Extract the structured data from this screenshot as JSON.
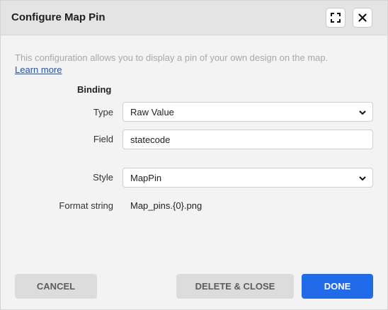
{
  "dialog": {
    "title": "Configure Map Pin",
    "expand_icon": "expand-icon",
    "close_icon": "close-icon"
  },
  "intro": {
    "description": "This configuration allows you to display a pin of your own design on the map.",
    "learn_more": "Learn more"
  },
  "binding": {
    "section_title": "Binding",
    "type_label": "Type",
    "type_value": "Raw Value",
    "field_label": "Field",
    "field_value": "statecode"
  },
  "style": {
    "style_label": "Style",
    "style_value": "MapPin",
    "format_label": "Format string",
    "format_value": "Map_pins.{0}.png"
  },
  "footer": {
    "cancel": "CANCEL",
    "delete_close": "DELETE & CLOSE",
    "done": "DONE"
  },
  "colors": {
    "primary": "#1f6bea",
    "link": "#1f53b8",
    "secondary_button": "#dcdcdc"
  }
}
